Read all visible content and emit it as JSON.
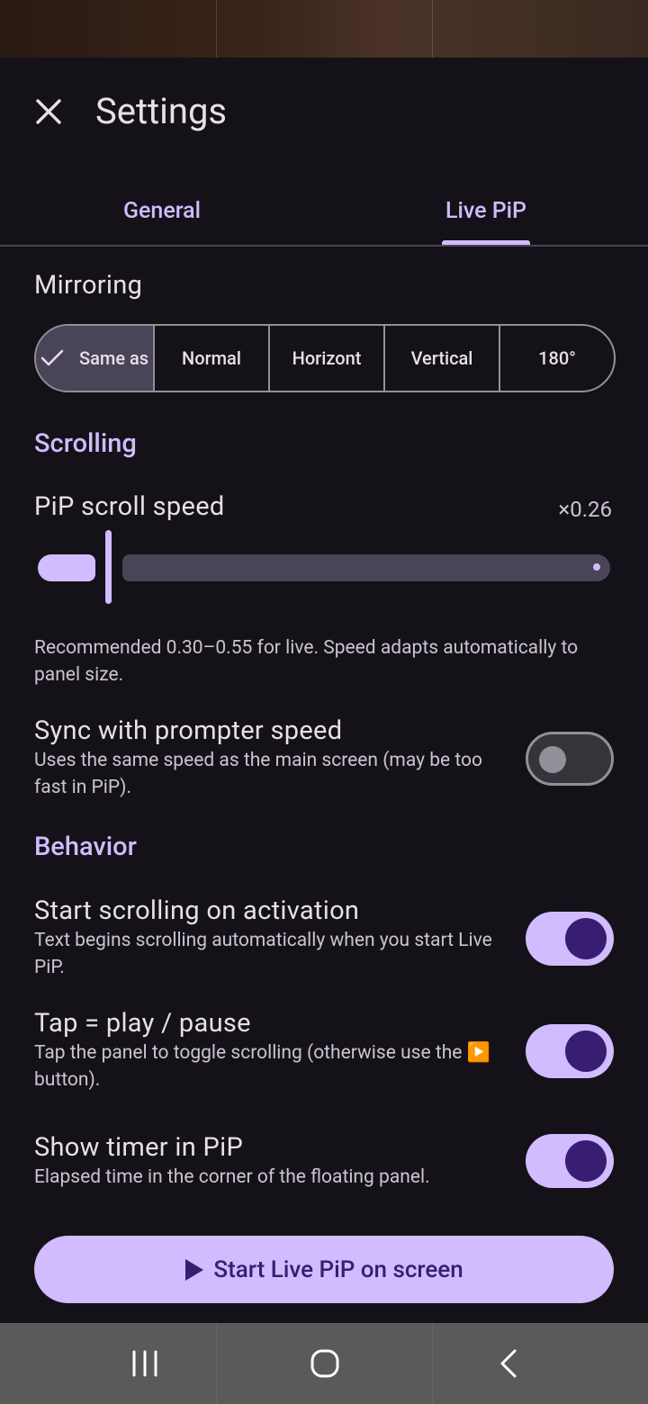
{
  "header": {
    "title": "Settings",
    "close_icon": "close-icon"
  },
  "tabs": [
    {
      "label": "General",
      "selected": false
    },
    {
      "label": "Live PiP",
      "selected": true
    }
  ],
  "mirroring": {
    "label": "Mirroring",
    "options": [
      "Same as",
      "Normal",
      "Horizont",
      "Vertical",
      "180°"
    ],
    "selected": "Same as"
  },
  "scrolling": {
    "section_label": "Scrolling",
    "speed_label": "PiP scroll speed",
    "speed_value": "×0.26",
    "speed_fraction": 0.26,
    "hint": "Recommended 0.30–0.55 for live. Speed adapts automatically to panel size.",
    "sync": {
      "title": "Sync with prompter speed",
      "description": "Uses the same speed as the main screen (may be too fast in PiP).",
      "enabled": false
    }
  },
  "behavior": {
    "section_label": "Behavior",
    "items": [
      {
        "title": "Start scrolling on activation",
        "description": "Text begins scrolling automatically when you start Live PiP.",
        "enabled": true
      },
      {
        "title": "Tap = play / pause",
        "description": "Tap the panel to toggle scrolling (otherwise use the ▶️ button).",
        "enabled": true
      },
      {
        "title": "Show timer in PiP",
        "description": "Elapsed time in the corner of the floating panel.",
        "enabled": true
      }
    ]
  },
  "cta": {
    "label": "Start Live PiP on screen",
    "icon": "play-icon"
  },
  "colors": {
    "accent": "#D0BCFF",
    "background": "#141218",
    "on_accent": "#381E72"
  },
  "system_nav": {
    "icons": [
      "recents-icon",
      "home-icon",
      "back-icon"
    ]
  }
}
